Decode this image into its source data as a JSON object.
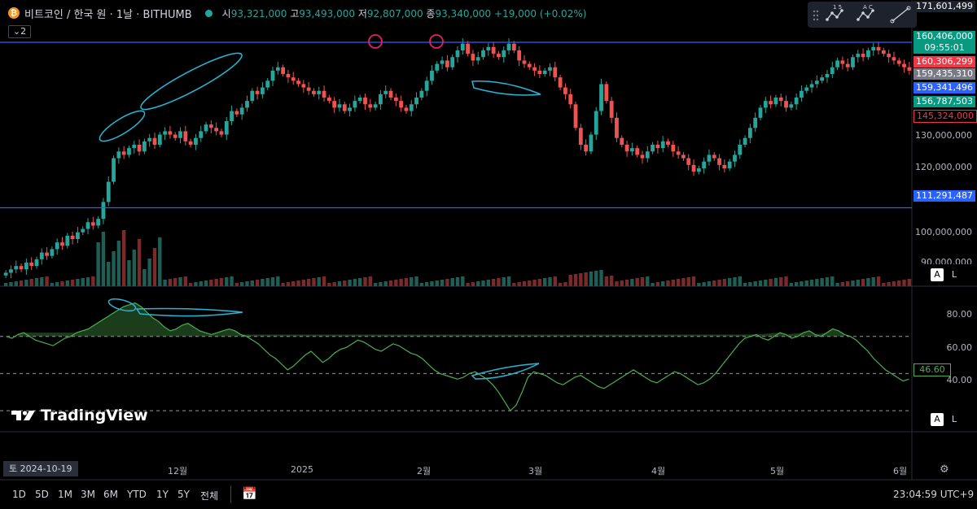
{
  "header": {
    "symbol": "비트코인 / 한국 원 · 1날 · BITHUMB",
    "open_label": "시",
    "open": "93,321,000",
    "high_label": "고",
    "high": "93,493,000",
    "low_label": "저",
    "low": "92,807,000",
    "close_label": "종",
    "close": "93,340,000",
    "change": "+19,000 (+0.02%)"
  },
  "legend_toggle": "2",
  "colors": {
    "up": "#26a69a",
    "down": "#ef5350",
    "line": "#2962ff",
    "rsi": "#4caf50",
    "annotation": "#29b6d6",
    "marker": "#e91e63"
  },
  "price_tags": [
    {
      "value": "171,601,499",
      "bg": "#1e222d",
      "y": 1
    },
    {
      "value": "160,406,000",
      "bg": "#089981",
      "y": 38
    },
    {
      "value": "09:55:01",
      "bg": "#089981",
      "y": 52
    },
    {
      "value": "160,306,299",
      "bg": "#f23645",
      "y": 69
    },
    {
      "value": "159,435,310",
      "bg": "#787b86",
      "y": 84
    },
    {
      "value": "159,341,496",
      "bg": "#2962ff",
      "y": 101
    },
    {
      "value": "156,787,503",
      "bg": "#089981",
      "y": 118
    },
    {
      "value": "145,324,000",
      "bg": "#000000",
      "y": 135
    },
    {
      "value": "111,291,487",
      "bg": "#2962ff",
      "y": 234
    }
  ],
  "price_ticks": [
    "130,000,000",
    "120,000,000",
    "100,000,000",
    "90,000,000"
  ],
  "rsi_ticks": [
    "80.00",
    "60.00",
    "40.00"
  ],
  "rsi_value": "46.60",
  "x_ticks": [
    "12월",
    "2025",
    "2월",
    "3월",
    "4월",
    "5월",
    "6월"
  ],
  "date_badge": "토 2024-10-19",
  "timeframes": [
    "1D",
    "5D",
    "1M",
    "3M",
    "6M",
    "YTD",
    "1Y",
    "5Y",
    "전체"
  ],
  "clock": "23:04:59 UTC+9",
  "brand": "TradingView",
  "scale_buttons": [
    "A",
    "L"
  ],
  "toolbox_labels": {
    "fib": "1  5",
    "abc": "A  C"
  },
  "chart_data": {
    "type": "candlestick",
    "x_start": "2024-10-19",
    "interval": "1D",
    "price_range": [
      88000000,
      172000000
    ],
    "key_levels": [
      160406000,
      111291487
    ],
    "closes_shape": [
      92,
      93,
      94,
      93,
      95,
      94,
      96,
      98,
      97,
      99,
      101,
      100,
      103,
      102,
      104,
      105,
      107,
      106,
      108,
      113,
      119,
      126,
      128,
      127,
      129,
      130,
      128,
      131,
      132,
      130,
      133,
      134,
      133,
      132,
      134,
      131,
      130,
      132,
      134,
      136,
      135,
      134,
      133,
      137,
      140,
      139,
      141,
      143,
      146,
      145,
      147,
      149,
      152,
      153,
      151,
      150,
      149,
      148,
      147,
      146,
      145,
      146,
      144,
      143,
      141,
      142,
      140,
      141,
      143,
      144,
      142,
      141,
      142,
      145,
      146,
      144,
      143,
      141,
      140,
      142,
      144,
      146,
      149,
      152,
      154,
      155,
      153,
      156,
      158,
      160,
      157,
      155,
      156,
      158,
      159,
      157,
      156,
      158,
      160,
      158,
      155,
      154,
      153,
      152,
      151,
      152,
      153,
      150,
      147,
      145,
      142,
      135,
      130,
      128,
      133,
      140,
      148,
      143,
      138,
      132,
      130,
      128,
      129,
      127,
      126,
      128,
      130,
      129,
      131,
      130,
      128,
      127,
      126,
      124,
      122,
      123,
      125,
      127,
      126,
      124,
      123,
      125,
      127,
      130,
      132,
      135,
      138,
      141,
      143,
      142,
      144,
      143,
      141,
      142,
      144,
      146,
      147,
      148,
      149,
      150,
      151,
      153,
      155,
      154,
      153,
      156,
      157,
      156,
      158,
      159,
      158,
      157,
      156,
      155,
      154,
      153,
      152
    ],
    "rsi_shape": [
      70,
      69,
      71,
      72,
      70,
      68,
      67,
      66,
      65,
      67,
      69,
      70,
      72,
      73,
      74,
      76,
      78,
      80,
      82,
      84,
      86,
      87,
      88,
      86,
      83,
      80,
      78,
      75,
      73,
      74,
      76,
      77,
      75,
      73,
      72,
      71,
      72,
      73,
      74,
      73,
      71,
      70,
      68,
      66,
      63,
      60,
      58,
      55,
      52,
      54,
      57,
      60,
      62,
      59,
      56,
      58,
      61,
      63,
      64,
      66,
      68,
      67,
      65,
      63,
      62,
      64,
      66,
      65,
      63,
      61,
      60,
      58,
      55,
      52,
      50,
      49,
      48,
      47,
      48,
      50,
      51,
      49,
      47,
      44,
      40,
      35,
      30,
      33,
      40,
      48,
      51,
      50,
      49,
      47,
      45,
      44,
      46,
      48,
      49,
      47,
      45,
      43,
      42,
      44,
      46,
      48,
      50,
      52,
      50,
      48,
      46,
      45,
      47,
      49,
      51,
      50,
      48,
      46,
      44,
      45,
      47,
      50,
      54,
      58,
      62,
      66,
      69,
      70,
      71,
      69,
      68,
      70,
      72,
      71,
      69,
      70,
      72,
      73,
      71,
      70,
      72,
      74,
      73,
      71,
      70,
      68,
      65,
      62,
      58,
      55,
      52,
      50,
      48,
      46,
      47
    ],
    "rsi_levels": [
      70,
      50,
      30
    ],
    "rsi_range": [
      20,
      90
    ]
  }
}
